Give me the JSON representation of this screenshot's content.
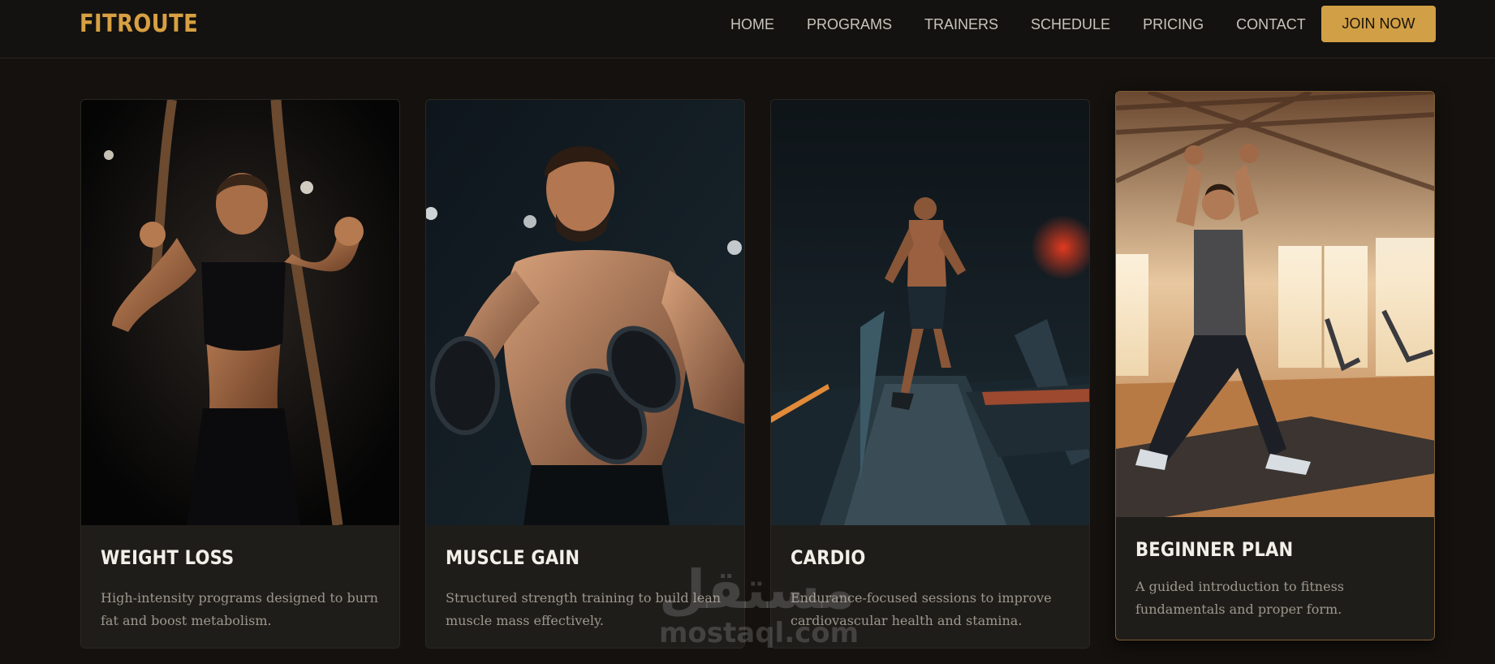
{
  "brand": {
    "name": "FITROUTE",
    "color": "#d8a042"
  },
  "nav": {
    "links": [
      "HOME",
      "PROGRAMS",
      "TRAINERS",
      "SCHEDULE",
      "PRICING",
      "CONTACT"
    ],
    "cta": "JOIN NOW"
  },
  "programs": [
    {
      "title": "WEIGHT LOSS",
      "description": "High-intensity programs designed to burn fat and boost metabolism.",
      "image_icon": "battle-ropes-photo"
    },
    {
      "title": "MUSCLE GAIN",
      "description": "Structured strength training to build lean muscle mass effectively.",
      "image_icon": "dumbbell-curl-photo"
    },
    {
      "title": "CARDIO",
      "description": "Endurance-focused sessions to improve cardiovascular health and stamina.",
      "image_icon": "treadmill-run-photo"
    },
    {
      "title": "BEGINNER PLAN",
      "description": "A guided introduction to fitness fundamentals and proper form.",
      "image_icon": "stretch-pose-photo",
      "featured": true
    }
  ],
  "watermark": {
    "arabic": "مستقل",
    "latin": "mostaql.com"
  },
  "colors": {
    "background": "#14110e",
    "accent": "#d19f45",
    "card": "#1f1d1a"
  }
}
